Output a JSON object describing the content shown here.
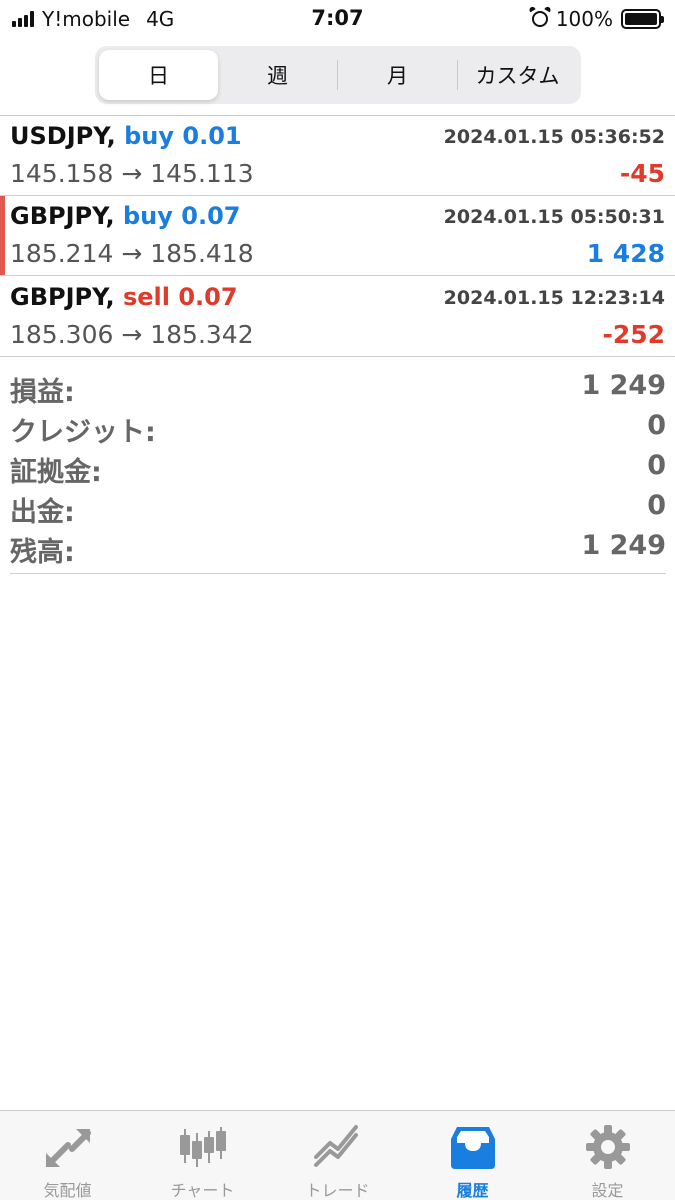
{
  "status_bar": {
    "carrier": "Y!mobile",
    "network": "4G",
    "time": "7:07",
    "battery": "100%"
  },
  "period_tabs": [
    {
      "label": "日",
      "active": true
    },
    {
      "label": "週",
      "active": false
    },
    {
      "label": "月",
      "active": false
    },
    {
      "label": "カスタム",
      "active": false
    }
  ],
  "trades": [
    {
      "pair": "USDJPY,",
      "side": "buy 0.01",
      "datetime": "2024.01.15 05:36:52",
      "prices": "145.158 → 145.113",
      "profit": "-45",
      "profit_sign": "negative"
    },
    {
      "pair": "GBPJPY,",
      "side": "buy 0.07",
      "datetime": "2024.01.15 05:50:31",
      "prices": "185.214 → 185.418",
      "profit": "1 428",
      "profit_sign": "positive"
    },
    {
      "pair": "GBPJPY,",
      "side": "sell 0.07",
      "datetime": "2024.01.15 12:23:14",
      "prices": "185.306 → 185.342",
      "profit": "-252",
      "profit_sign": "negative"
    }
  ],
  "summary": [
    {
      "label": "損益:",
      "value": "1 249"
    },
    {
      "label": "クレジット:",
      "value": "0"
    },
    {
      "label": "証拠金:",
      "value": "0"
    },
    {
      "label": "出金:",
      "value": "0"
    },
    {
      "label": "残高:",
      "value": "1 249"
    }
  ],
  "tab_bar": [
    {
      "label": "気配値",
      "icon": "quotes-icon",
      "active": false
    },
    {
      "label": "チャート",
      "icon": "chart-icon",
      "active": false
    },
    {
      "label": "トレード",
      "icon": "trade-icon",
      "active": false
    },
    {
      "label": "履歴",
      "icon": "history-icon",
      "active": true
    },
    {
      "label": "設定",
      "icon": "settings-icon",
      "active": false
    }
  ],
  "colors": {
    "accent_blue": "#1a7ee0",
    "loss_red": "#e03a2a",
    "inactive_gray": "#999999"
  }
}
